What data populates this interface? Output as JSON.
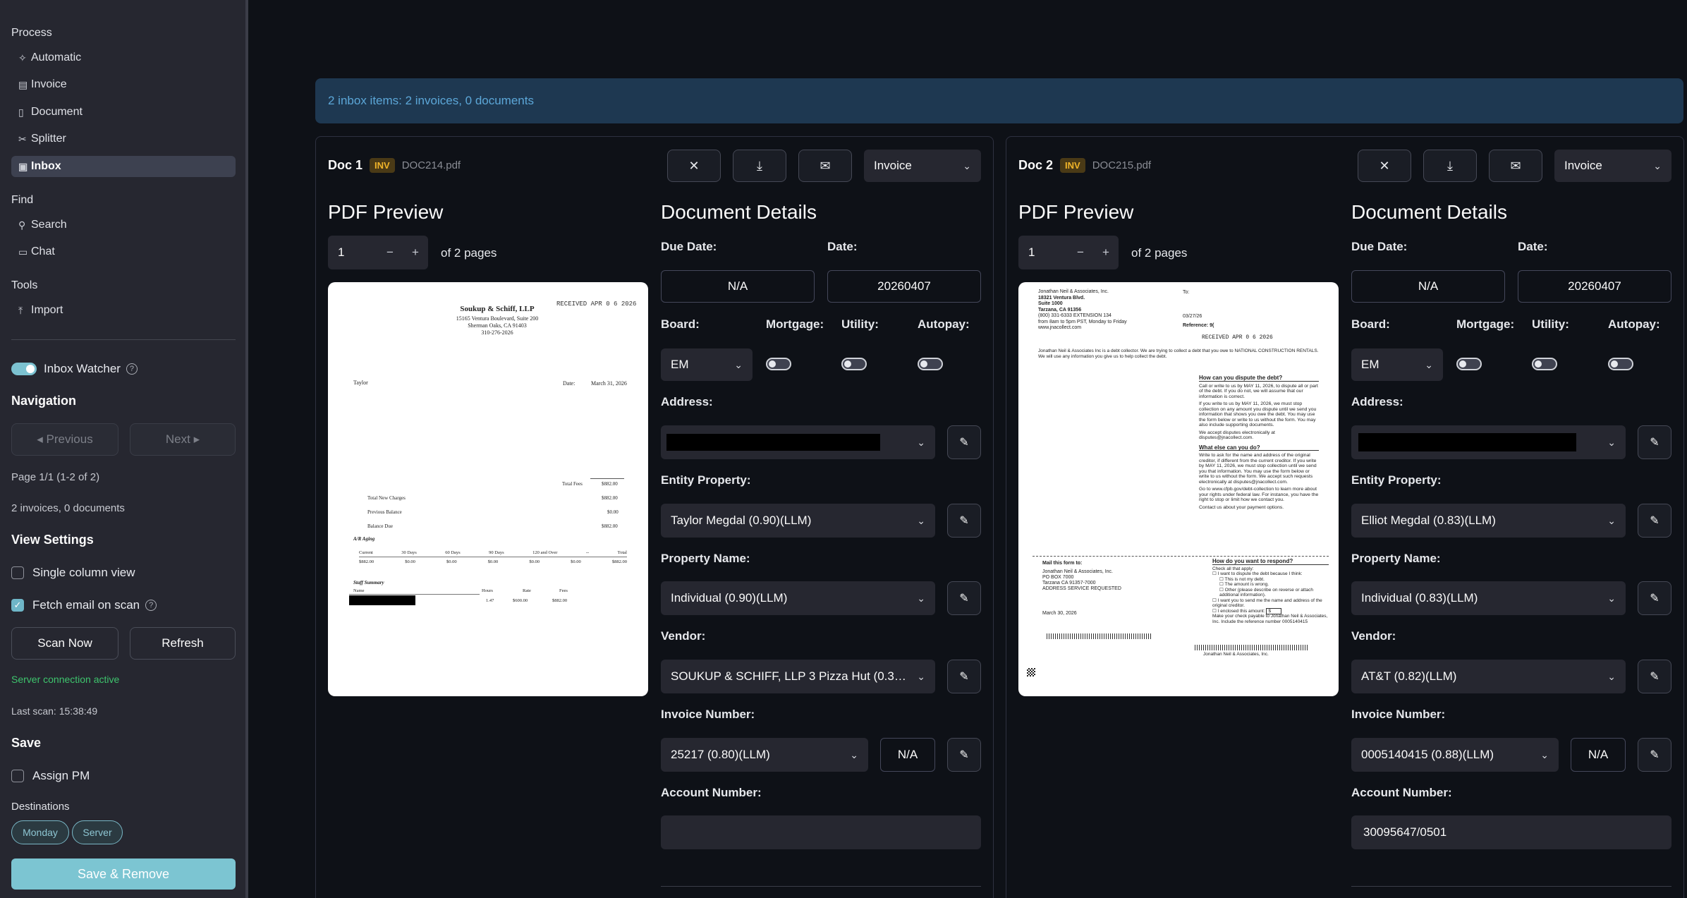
{
  "sidebar": {
    "process_header": "Process",
    "process_items": [
      {
        "label": "Automatic",
        "icon": "sparkles-icon",
        "glyph": "✧"
      },
      {
        "label": "Invoice",
        "icon": "receipt-icon",
        "glyph": "▤"
      },
      {
        "label": "Document",
        "icon": "document-icon",
        "glyph": "▯"
      },
      {
        "label": "Splitter",
        "icon": "scissors-icon",
        "glyph": "✂"
      },
      {
        "label": "Inbox",
        "icon": "inbox-icon",
        "glyph": "▣",
        "active": true
      }
    ],
    "find_header": "Find",
    "find_items": [
      {
        "label": "Search",
        "icon": "search-icon",
        "glyph": "⚲"
      },
      {
        "label": "Chat",
        "icon": "chat-icon",
        "glyph": "▭"
      }
    ],
    "tools_header": "Tools",
    "tools_items": [
      {
        "label": "Import",
        "icon": "upload-icon",
        "glyph": "⤒"
      }
    ],
    "inbox_watcher_label": "Inbox Watcher",
    "navigation_header": "Navigation",
    "previous_label": "◂ Previous",
    "next_label": "Next ▸",
    "page_info": "Page 1/1 (1-2 of 2)",
    "count_info": "2 invoices, 0 documents",
    "view_settings_header": "View Settings",
    "single_column_label": "Single column view",
    "fetch_email_label": "Fetch email on scan",
    "scan_now_label": "Scan Now",
    "refresh_label": "Refresh",
    "server_status": "Server connection active",
    "server_status_color": "#3ec46d",
    "last_scan": "Last scan: 15:38:49",
    "save_header": "Save",
    "assign_pm_label": "Assign PM",
    "destinations_label": "Destinations",
    "destinations": [
      "Monday",
      "Server"
    ],
    "save_remove_label": "Save & Remove"
  },
  "banner_text": "2 inbox items: 2 invoices, 0 documents",
  "docs": [
    {
      "title": "Doc 1",
      "badge": "INV",
      "filename": "DOC214.pdf",
      "type_select": "Invoice",
      "pdf_preview_header": "PDF Preview",
      "page_value": "1",
      "page_total": "of 2 pages",
      "details_header": "Document Details",
      "due_date_label": "Due Date:",
      "due_date": "N/A",
      "date_label": "Date:",
      "date": "20260407",
      "board_label": "Board:",
      "board": "EM",
      "mortgage_label": "Mortgage:",
      "utility_label": "Utility:",
      "autopay_label": "Autopay:",
      "address_label": "Address:",
      "entity_label": "Entity Property:",
      "entity": "Taylor Megdal (0.90)(LLM)",
      "property_label": "Property Name:",
      "property": "Individual (0.90)(LLM)",
      "vendor_label": "Vendor:",
      "vendor": "SOUKUP & SCHIFF, LLP 3 Pizza Hut (0.33…",
      "invoice_label": "Invoice Number:",
      "invoice": "25217 (0.80)(LLM)",
      "invoice_alt": "N/A",
      "account_label": "Account Number:",
      "account": "",
      "pdf": {
        "firm": "Soukup & Schiff, LLP",
        "addr1": "15165 Ventura Boulevard, Suite 200",
        "addr2": "Sherman Oaks, CA 91403",
        "phone": "310-276-2026",
        "stamp": "RECEIVED APR 0 6 2026",
        "to": "Taylor",
        "date_lbl": "Date:",
        "date_val": "March 31, 2026",
        "total_fees": "Total Fees",
        "tf_val": "$882.00",
        "total_new": "Total New Charges",
        "tn_val": "$882.00",
        "prev_bal": "Previous Balance",
        "pb_val": "$0.00",
        "bal_due": "Balance Due",
        "bd_val": "$882.00",
        "aging": "A/R Aging",
        "aging_heads": [
          "Current",
          "30 Days",
          "60 Days",
          "90 Days",
          "120 and Over",
          "--",
          "Total"
        ],
        "aging_vals": [
          "$882.00",
          "$0.00",
          "$0.00",
          "$0.00",
          "$0.00",
          "$0.00",
          "$882.00"
        ],
        "staff": "Staff Summary",
        "staff_heads": [
          "Name",
          "Hours",
          "Rate",
          "Fees"
        ],
        "staff_vals": [
          "1.47",
          "$600.00",
          "$882.00"
        ]
      }
    },
    {
      "title": "Doc 2",
      "badge": "INV",
      "filename": "DOC215.pdf",
      "type_select": "Invoice",
      "pdf_preview_header": "PDF Preview",
      "page_value": "1",
      "page_total": "of 2 pages",
      "details_header": "Document Details",
      "due_date_label": "Due Date:",
      "due_date": "N/A",
      "date_label": "Date:",
      "date": "20260407",
      "board_label": "Board:",
      "board": "EM",
      "mortgage_label": "Mortgage:",
      "utility_label": "Utility:",
      "autopay_label": "Autopay:",
      "address_label": "Address:",
      "entity_label": "Entity Property:",
      "entity": "Elliot Megdal (0.83)(LLM)",
      "property_label": "Property Name:",
      "property": "Individual (0.83)(LLM)",
      "vendor_label": "Vendor:",
      "vendor": "AT&T (0.82)(LLM)",
      "invoice_label": "Invoice Number:",
      "invoice": "0005140415 (0.88)(LLM)",
      "invoice_alt": "N/A",
      "account_label": "Account Number:",
      "account": "30095647/0501",
      "pdf": {
        "sender1": "Jonathan Neil & Associates, Inc.",
        "sender2": "18321 Ventura Blvd.",
        "sender3": "Suite 1000",
        "sender4": "Tarzana, CA 91356",
        "sender5": "(800) 331-6333 EXTENSION 134",
        "sender6": "from 8am to 5pm PST, Monday to Friday",
        "sender7": "www.jnacollect.com",
        "to": "To:",
        "date": "03/27/26",
        "stamp": "RECEIVED APR 0 6 2026",
        "reference": "Reference: 9(",
        "notice": "Jonathan Neil & Associates Inc is a debt collector. We are trying to collect a debt that you owe to NATIONAL CONSTRUCTION RENTALS. We will use any information you give us to help collect the debt.",
        "dispute_head": "How can you dispute the debt?",
        "dispute1": "Call or write to us by MAY 11, 2026, to dispute all or part of the debt. If you do not, we will assume that our information is correct.",
        "dispute2": "If you write to us by MAY 11, 2026, we must stop collection on any amount you dispute until we send you information that shows you owe the debt. You may use the form below or write to us without the form. You may also include supporting documents.",
        "dispute3": "We accept disputes electronically at disputes@jnacollect.com.",
        "else_head": "What else can you do?",
        "else1": "Write to ask for the name and address of the original creditor, if different from the current creditor. If you write by MAY 11, 2026, we must stop collection until we send you that information. You may use the form below or write to us without the form. We accept such requests electronically at disputes@jnacollect.com.",
        "else2": "Go to www.cfpb.gov/debt-collection to learn more about your rights under federal law. For instance, you have the right to stop or limit how we contact you.",
        "else3": "Contact us about your payment options.",
        "mail_head": "Mail this form to:",
        "mail1": "Jonathan Neil & Associates, Inc.",
        "mail2": "PO BOX 7000",
        "mail3": "Tarzana CA 91357-7000",
        "mail4": "ADDRESS SERVICE REQUESTED",
        "respond_head": "How do you want to respond?",
        "respond0": "Check all that apply:",
        "respond1": "I want to dispute the debt because I think:",
        "respond2": "This is not my debt.",
        "respond3": "The amount is wrong.",
        "respond4": "Other (please describe on reverse or attach additional information).",
        "respond5": "I want you to send me the name and address of the original creditor.",
        "respond6": "I enclosed this amount:",
        "respond6_field": "$",
        "respond7": "Make your check payable to Jonathan Neil & Associates, Inc. Include the reference number 0005140415",
        "mail_date": "March 30, 2026",
        "footer": "Jonathan Neil & Associates, Inc."
      }
    }
  ]
}
